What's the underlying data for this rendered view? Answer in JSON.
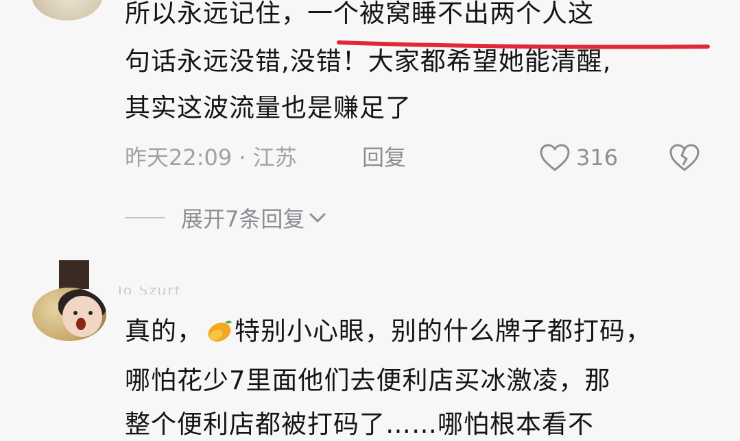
{
  "comment1": {
    "lines": [
      "所以永远记住，一个被窝睡不出两个人这",
      "句话永远没错,没错！大家都希望她能清醒,",
      "其实这波流量也是赚足了"
    ],
    "meta": "昨天22:09 · 江苏",
    "reply_label": "回复",
    "like_count": "316",
    "expand_label": "展开7条回复",
    "icons": {
      "like": "heart-outline-icon",
      "dislike": "broken-heart-icon",
      "expand": "chevron-down-icon"
    }
  },
  "comment2": {
    "username": "Jo Szurt",
    "line1_before": "真的，",
    "line1_after": "特别小心眼，别的什么牌子都打码，",
    "line2": "哪怕花少7里面他们去便利店买冰激凌，那",
    "line3": "整个便利店都被打码了……哪怕根本看不",
    "emoji": "mango-icon"
  },
  "colors": {
    "text": "#141414",
    "meta": "#a0a0a6",
    "underline": "#e0283a",
    "background": "#f7f7f8"
  }
}
